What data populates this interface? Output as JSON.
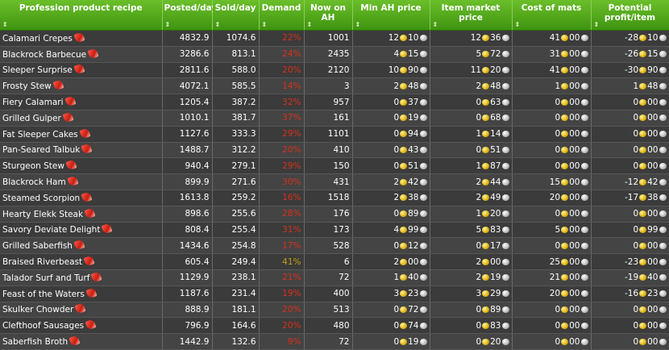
{
  "columns": [
    {
      "key": "recipe",
      "label": "Profession product recipe"
    },
    {
      "key": "posted",
      "label": "Posted/day"
    },
    {
      "key": "sold",
      "label": "Sold/day"
    },
    {
      "key": "demand",
      "label": "Demand"
    },
    {
      "key": "now_on_ah",
      "label": "Now on AH"
    },
    {
      "key": "min_ah",
      "label": "Min AH price"
    },
    {
      "key": "market",
      "label": "Item market price"
    },
    {
      "key": "cost",
      "label": "Cost of mats"
    },
    {
      "key": "profit",
      "label": "Potential profit/item"
    }
  ],
  "sort_glyph": "⇕",
  "colors": {
    "header": "#4fa318",
    "demand_high": "#d8311a",
    "demand_mid": "#c89d10"
  },
  "rows": [
    {
      "name": "Calamari Crepes",
      "posted": "4832.9",
      "sold": "1074.6",
      "demand": "22%",
      "now": "1001",
      "min_g": "12",
      "min_s": "10",
      "mkt_g": "12",
      "mkt_s": "36",
      "cost_g": "41",
      "cost_s": "00",
      "profit_g": "-28",
      "profit_s": "10"
    },
    {
      "name": "Blackrock Barbecue",
      "posted": "3286.6",
      "sold": "813.1",
      "demand": "24%",
      "now": "2435",
      "min_g": "4",
      "min_s": "15",
      "mkt_g": "5",
      "mkt_s": "72",
      "cost_g": "31",
      "cost_s": "00",
      "profit_g": "-26",
      "profit_s": "15"
    },
    {
      "name": "Sleeper Surprise",
      "posted": "2811.6",
      "sold": "588.0",
      "demand": "20%",
      "now": "2120",
      "min_g": "10",
      "min_s": "90",
      "mkt_g": "11",
      "mkt_s": "20",
      "cost_g": "41",
      "cost_s": "00",
      "profit_g": "-30",
      "profit_s": "90"
    },
    {
      "name": "Frosty Stew",
      "posted": "4072.1",
      "sold": "585.5",
      "demand": "14%",
      "now": "3",
      "min_g": "2",
      "min_s": "48",
      "mkt_g": "2",
      "mkt_s": "48",
      "cost_g": "1",
      "cost_s": "00",
      "profit_g": "1",
      "profit_s": "48"
    },
    {
      "name": "Fiery Calamari",
      "posted": "1205.4",
      "sold": "387.2",
      "demand": "32%",
      "now": "957",
      "min_g": "0",
      "min_s": "37",
      "mkt_g": "0",
      "mkt_s": "63",
      "cost_g": "0",
      "cost_s": "00",
      "profit_g": "0",
      "profit_s": "00"
    },
    {
      "name": "Grilled Gulper",
      "posted": "1010.1",
      "sold": "381.7",
      "demand": "37%",
      "now": "161",
      "min_g": "0",
      "min_s": "19",
      "mkt_g": "0",
      "mkt_s": "68",
      "cost_g": "0",
      "cost_s": "00",
      "profit_g": "0",
      "profit_s": "00"
    },
    {
      "name": "Fat Sleeper Cakes",
      "posted": "1127.6",
      "sold": "333.3",
      "demand": "29%",
      "now": "1101",
      "min_g": "0",
      "min_s": "94",
      "mkt_g": "1",
      "mkt_s": "14",
      "cost_g": "0",
      "cost_s": "00",
      "profit_g": "0",
      "profit_s": "00"
    },
    {
      "name": "Pan-Seared Talbuk",
      "posted": "1488.7",
      "sold": "312.2",
      "demand": "20%",
      "now": "410",
      "min_g": "0",
      "min_s": "43",
      "mkt_g": "0",
      "mkt_s": "51",
      "cost_g": "0",
      "cost_s": "00",
      "profit_g": "0",
      "profit_s": "00"
    },
    {
      "name": "Sturgeon Stew",
      "posted": "940.4",
      "sold": "279.1",
      "demand": "29%",
      "now": "150",
      "min_g": "0",
      "min_s": "51",
      "mkt_g": "1",
      "mkt_s": "87",
      "cost_g": "0",
      "cost_s": "00",
      "profit_g": "0",
      "profit_s": "00"
    },
    {
      "name": "Blackrock Ham",
      "posted": "899.9",
      "sold": "271.6",
      "demand": "30%",
      "now": "431",
      "min_g": "2",
      "min_s": "42",
      "mkt_g": "2",
      "mkt_s": "44",
      "cost_g": "15",
      "cost_s": "00",
      "profit_g": "-12",
      "profit_s": "42"
    },
    {
      "name": "Steamed Scorpion",
      "posted": "1613.8",
      "sold": "259.2",
      "demand": "16%",
      "now": "1518",
      "min_g": "2",
      "min_s": "38",
      "mkt_g": "2",
      "mkt_s": "49",
      "cost_g": "20",
      "cost_s": "00",
      "profit_g": "-17",
      "profit_s": "38"
    },
    {
      "name": "Hearty Elekk Steak",
      "posted": "898.6",
      "sold": "255.6",
      "demand": "28%",
      "now": "176",
      "min_g": "0",
      "min_s": "89",
      "mkt_g": "1",
      "mkt_s": "20",
      "cost_g": "0",
      "cost_s": "00",
      "profit_g": "0",
      "profit_s": "00"
    },
    {
      "name": "Savory Deviate Delight",
      "posted": "808.4",
      "sold": "255.4",
      "demand": "31%",
      "now": "173",
      "min_g": "4",
      "min_s": "99",
      "mkt_g": "5",
      "mkt_s": "83",
      "cost_g": "5",
      "cost_s": "00",
      "profit_g": "0",
      "profit_s": "99"
    },
    {
      "name": "Grilled Saberfish",
      "posted": "1434.6",
      "sold": "254.8",
      "demand": "17%",
      "now": "528",
      "min_g": "0",
      "min_s": "12",
      "mkt_g": "0",
      "mkt_s": "17",
      "cost_g": "0",
      "cost_s": "00",
      "profit_g": "0",
      "profit_s": "00"
    },
    {
      "name": "Braised Riverbeast",
      "posted": "605.4",
      "sold": "249.4",
      "demand": "41%",
      "now": "6",
      "min_g": "2",
      "min_s": "00",
      "mkt_g": "2",
      "mkt_s": "00",
      "cost_g": "25",
      "cost_s": "00",
      "profit_g": "-23",
      "profit_s": "00"
    },
    {
      "name": "Talador Surf and Turf",
      "posted": "1129.9",
      "sold": "238.1",
      "demand": "21%",
      "now": "72",
      "min_g": "1",
      "min_s": "40",
      "mkt_g": "2",
      "mkt_s": "19",
      "cost_g": "21",
      "cost_s": "00",
      "profit_g": "-19",
      "profit_s": "40"
    },
    {
      "name": "Feast of the Waters",
      "posted": "1187.6",
      "sold": "231.4",
      "demand": "19%",
      "now": "400",
      "min_g": "3",
      "min_s": "23",
      "mkt_g": "3",
      "mkt_s": "29",
      "cost_g": "20",
      "cost_s": "00",
      "profit_g": "-16",
      "profit_s": "23"
    },
    {
      "name": "Skulker Chowder",
      "posted": "888.9",
      "sold": "181.1",
      "demand": "20%",
      "now": "513",
      "min_g": "0",
      "min_s": "72",
      "mkt_g": "0",
      "mkt_s": "89",
      "cost_g": "0",
      "cost_s": "00",
      "profit_g": "0",
      "profit_s": "00"
    },
    {
      "name": "Clefthoof Sausages",
      "posted": "796.9",
      "sold": "164.6",
      "demand": "20%",
      "now": "480",
      "min_g": "0",
      "min_s": "74",
      "mkt_g": "0",
      "mkt_s": "83",
      "cost_g": "0",
      "cost_s": "00",
      "profit_g": "0",
      "profit_s": "00"
    },
    {
      "name": "Saberfish Broth",
      "posted": "1442.9",
      "sold": "132.6",
      "demand": "9%",
      "now": "72",
      "min_g": "0",
      "min_s": "19",
      "mkt_g": "0",
      "mkt_s": "20",
      "cost_g": "0",
      "cost_s": "00",
      "profit_g": "0",
      "profit_s": "00"
    }
  ]
}
